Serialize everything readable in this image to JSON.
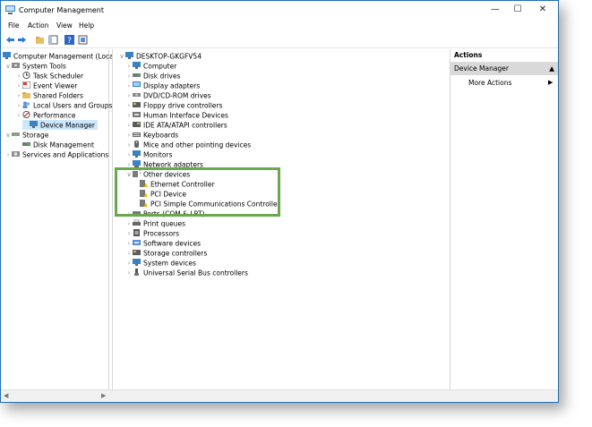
{
  "window": {
    "title": "Computer Management"
  },
  "menu": [
    "File",
    "Action",
    "View",
    "Help"
  ],
  "left_tree": [
    {
      "label": "Computer Management (Local",
      "indent": 0,
      "exp": ""
    },
    {
      "label": "System Tools",
      "indent": 1,
      "exp": "v"
    },
    {
      "label": "Task Scheduler",
      "indent": 2,
      "exp": ">"
    },
    {
      "label": "Event Viewer",
      "indent": 2,
      "exp": ">"
    },
    {
      "label": "Shared Folders",
      "indent": 2,
      "exp": ">"
    },
    {
      "label": "Local Users and Groups",
      "indent": 2,
      "exp": ">"
    },
    {
      "label": "Performance",
      "indent": 2,
      "exp": ">"
    },
    {
      "label": "Device Manager",
      "indent": 2,
      "exp": "",
      "selected": true
    },
    {
      "label": "Storage",
      "indent": 1,
      "exp": "v"
    },
    {
      "label": "Disk Management",
      "indent": 2,
      "exp": ""
    },
    {
      "label": "Services and Applications",
      "indent": 1,
      "exp": ">"
    }
  ],
  "device_tree": {
    "root": "DESKTOP-GKGFV54",
    "items": [
      {
        "label": "Computer"
      },
      {
        "label": "Disk drives"
      },
      {
        "label": "Display adapters"
      },
      {
        "label": "DVD/CD-ROM drives"
      },
      {
        "label": "Floppy drive controllers"
      },
      {
        "label": "Human Interface Devices"
      },
      {
        "label": "IDE ATA/ATAPI controllers"
      },
      {
        "label": "Keyboards"
      },
      {
        "label": "Mice and other pointing devices"
      },
      {
        "label": "Monitors"
      },
      {
        "label": "Network adapters"
      },
      {
        "label": "Other devices",
        "expanded": true
      },
      {
        "label": "Ethernet Controller",
        "child": true
      },
      {
        "label": "PCI Device",
        "child": true
      },
      {
        "label": "PCI Simple Communications Controller",
        "child": true
      },
      {
        "label": "Ports (COM & LPT)"
      },
      {
        "label": "Print queues"
      },
      {
        "label": "Processors"
      },
      {
        "label": "Software devices"
      },
      {
        "label": "Storage controllers"
      },
      {
        "label": "System devices"
      },
      {
        "label": "Universal Serial Bus controllers"
      }
    ]
  },
  "actions": {
    "header": "Actions",
    "section": "Device Manager",
    "more": "More Actions"
  },
  "colors": {
    "accent": "#1f6fb5",
    "selection": "#cce8ff",
    "highlight_border": "#6aa84f"
  }
}
